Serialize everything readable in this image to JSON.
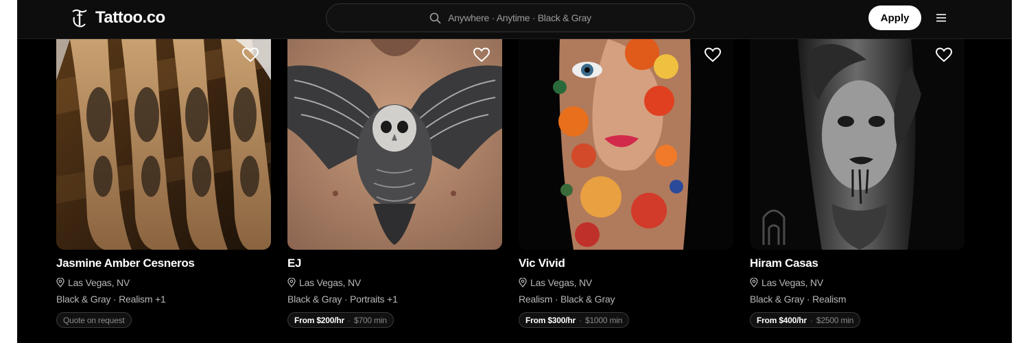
{
  "header": {
    "brand": "Tattoo.co",
    "search_text": "Anywhere · Anytime · Black & Gray",
    "apply_label": "Apply",
    "icons": {
      "logo": "tattoo-co-logo-icon",
      "search": "search-icon",
      "menu": "hamburger-menu-icon"
    }
  },
  "cards": [
    {
      "name": "Jasmine Amber Cesneros",
      "location": "Las Vegas, NV",
      "styles": "Black & Gray · Realism +1",
      "price_quote": "Quote on request",
      "image": "forearm-sleeve-tattoo-photo"
    },
    {
      "name": "EJ",
      "location": "Las Vegas, NV",
      "styles": "Black & Gray · Portraits +1",
      "price_rate": "From $200/hr",
      "price_sep": "·",
      "price_min": "$700 min",
      "image": "owl-chest-tattoo-photo"
    },
    {
      "name": "Vic Vivid",
      "location": "Las Vegas, NV",
      "styles": "Realism · Black & Gray",
      "price_rate": "From $300/hr",
      "price_sep": "·",
      "price_min": "$1000 min",
      "image": "floral-woman-portrait-tattoo-photo"
    },
    {
      "name": "Hiram Casas",
      "location": "Las Vegas, NV",
      "styles": "Black & Gray · Realism",
      "price_rate": "From $400/hr",
      "price_sep": "·",
      "price_min": "$2500 min",
      "image": "gothic-woman-sleeve-tattoo-photo"
    }
  ],
  "colors": {
    "background": "#000000",
    "header": "#0d0d0d",
    "text": "#ffffff",
    "muted": "#b8b8b8"
  }
}
